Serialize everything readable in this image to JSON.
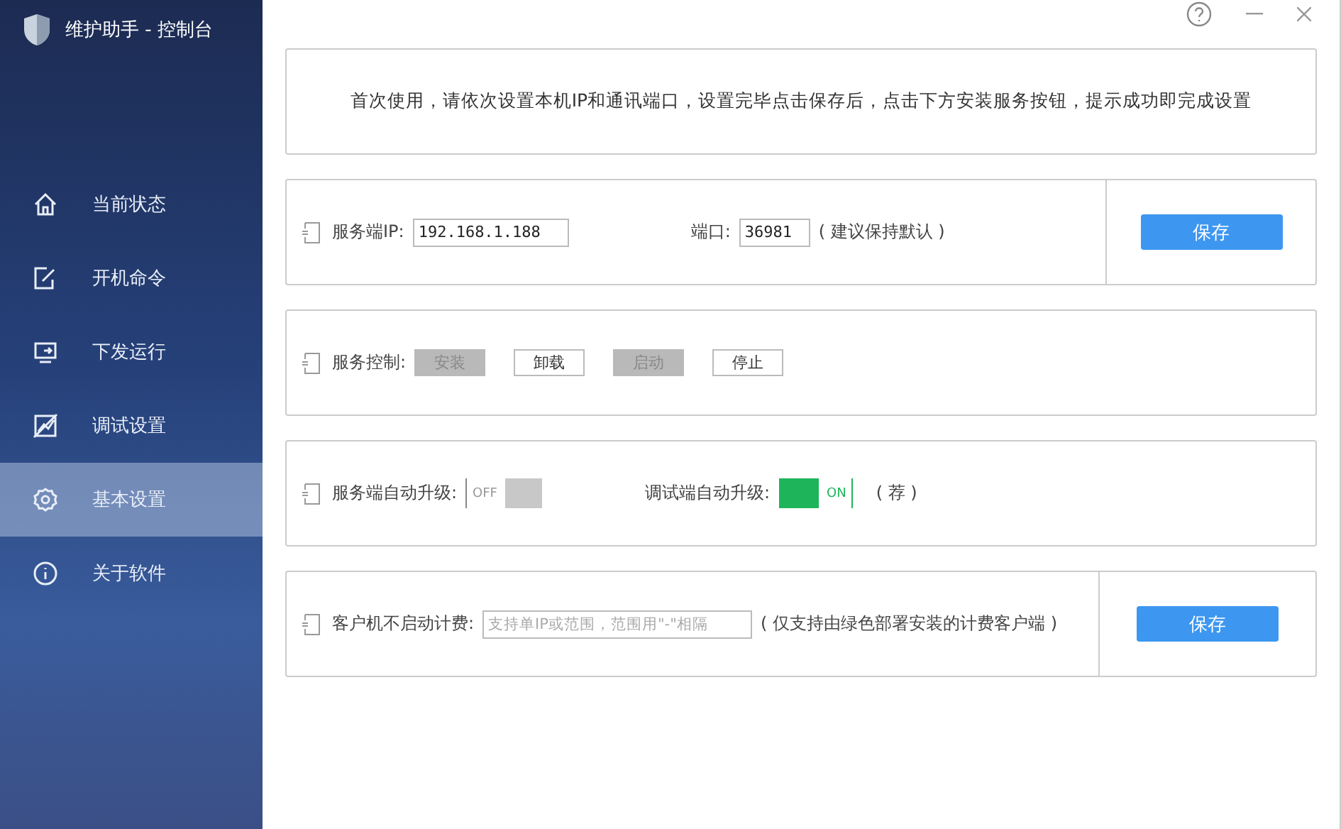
{
  "window": {
    "title": "维护助手 - 控制台"
  },
  "sidebar": {
    "items": [
      {
        "label": "当前状态",
        "selected": false
      },
      {
        "label": "开机命令",
        "selected": false
      },
      {
        "label": "下发运行",
        "selected": false
      },
      {
        "label": "调试设置",
        "selected": false
      },
      {
        "label": "基本设置",
        "selected": true
      },
      {
        "label": "关于软件",
        "selected": false
      }
    ]
  },
  "notice": "首次使用，请依次设置本机IP和通讯端口，设置完毕点击保存后，点击下方安装服务按钮，提示成功即完成设置",
  "server": {
    "ip_label": "服务端IP:",
    "ip_value": "192.168.1.188",
    "port_label": "端口:",
    "port_value": "36981",
    "hint": "( 建议保持默认 )",
    "save": "保存"
  },
  "service_control": {
    "label": "服务控制:",
    "buttons": [
      {
        "label": "安装",
        "disabled": true
      },
      {
        "label": "卸载",
        "disabled": false
      },
      {
        "label": "启动",
        "disabled": true
      },
      {
        "label": "停止",
        "disabled": false
      }
    ]
  },
  "upgrade": {
    "toggles": [
      {
        "label": "服务端自动升级:",
        "on": false,
        "state_text": "OFF"
      },
      {
        "label": "调试端自动升级:",
        "on": true,
        "state_text": "ON"
      }
    ],
    "note": "( 荐 )"
  },
  "billing": {
    "label": "客户机不启动计费:",
    "placeholder": "支持单IP或范围，范围用\"-\"相隔",
    "hint": "( 仅支持由绿色部署安装的计费客户端 )",
    "save": "保存"
  }
}
